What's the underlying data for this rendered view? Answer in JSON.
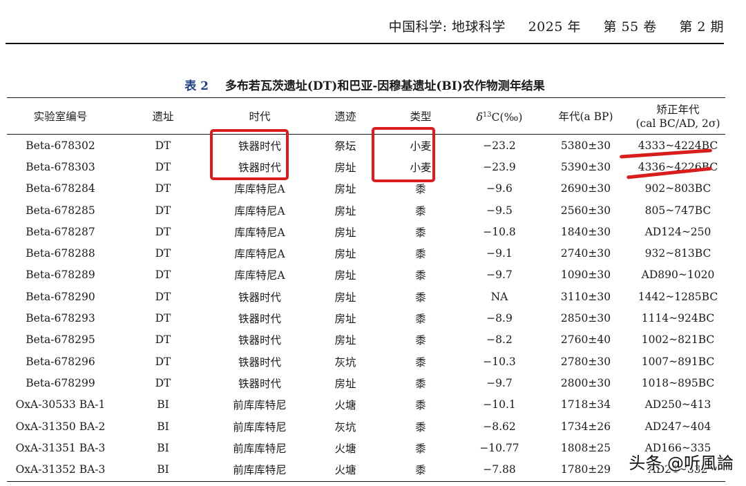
{
  "header": {
    "journal": "中国科学: 地球科学",
    "year": "2025 年",
    "volume": "第 55 卷",
    "issue": "第 2 期"
  },
  "caption": {
    "number": "表 2",
    "title": "多布若瓦茨遗址(DT)和巴亚-因穆基遗址(BI)农作物测年结果"
  },
  "table": {
    "headers": {
      "lab_id": "实验室编号",
      "site": "遗址",
      "period": "时代",
      "feature": "遗迹",
      "type": "类型",
      "delta_symbol": "δ",
      "delta_sup": "13",
      "delta_rest": "C(‰)",
      "age": "年代(a BP)",
      "cal_line1": "矫正年代",
      "cal_line2": "(cal BC/AD, 2σ)"
    },
    "rows": [
      {
        "lab_id": "Beta-678302",
        "site": "DT",
        "period": "铁器时代",
        "feature": "祭坛",
        "type": "小麦",
        "delta": "−23.2",
        "age": "5380±30",
        "cal": "4333~4224BC"
      },
      {
        "lab_id": "Beta-678303",
        "site": "DT",
        "period": "铁器时代",
        "feature": "房址",
        "type": "小麦",
        "delta": "−23.9",
        "age": "5390±30",
        "cal": "4336~4226BC"
      },
      {
        "lab_id": "Beta-678284",
        "site": "DT",
        "period": "库库特尼A",
        "feature": "房址",
        "type": "黍",
        "delta": "−9.6",
        "age": "2690±30",
        "cal": "902~803BC"
      },
      {
        "lab_id": "Beta-678285",
        "site": "DT",
        "period": "库库特尼A",
        "feature": "房址",
        "type": "黍",
        "delta": "−9.5",
        "age": "2560±30",
        "cal": "805~747BC"
      },
      {
        "lab_id": "Beta-678287",
        "site": "DT",
        "period": "库库特尼A",
        "feature": "房址",
        "type": "黍",
        "delta": "−10.8",
        "age": "1840±30",
        "cal": "AD124~250"
      },
      {
        "lab_id": "Beta-678288",
        "site": "DT",
        "period": "库库特尼A",
        "feature": "房址",
        "type": "黍",
        "delta": "−9.1",
        "age": "2740±30",
        "cal": "932~813BC"
      },
      {
        "lab_id": "Beta-678289",
        "site": "DT",
        "period": "库库特尼A",
        "feature": "房址",
        "type": "黍",
        "delta": "−9.7",
        "age": "1090±30",
        "cal": "AD890~1020"
      },
      {
        "lab_id": "Beta-678290",
        "site": "DT",
        "period": "铁器时代",
        "feature": "房址",
        "type": "黍",
        "delta": "NA",
        "age": "3110±30",
        "cal": "1442~1285BC"
      },
      {
        "lab_id": "Beta-678293",
        "site": "DT",
        "period": "铁器时代",
        "feature": "房址",
        "type": "黍",
        "delta": "−8.9",
        "age": "2850±30",
        "cal": "1114~924BC"
      },
      {
        "lab_id": "Beta-678295",
        "site": "DT",
        "period": "铁器时代",
        "feature": "房址",
        "type": "黍",
        "delta": "−8.2",
        "age": "2760±40",
        "cal": "1002~821BC"
      },
      {
        "lab_id": "Beta-678296",
        "site": "DT",
        "period": "铁器时代",
        "feature": "灰坑",
        "type": "黍",
        "delta": "−10.3",
        "age": "2780±30",
        "cal": "1007~891BC"
      },
      {
        "lab_id": "Beta-678299",
        "site": "DT",
        "period": "铁器时代",
        "feature": "房址",
        "type": "黍",
        "delta": "−9.7",
        "age": "2800±30",
        "cal": "1018~895BC"
      },
      {
        "lab_id": "OxA-30533 BA-1",
        "site": "BI",
        "period": "前库库特尼",
        "feature": "火塘",
        "type": "黍",
        "delta": "−10.1",
        "age": "1718±34",
        "cal": "AD250~413"
      },
      {
        "lab_id": "OxA-31350 BA-2",
        "site": "BI",
        "period": "前库库特尼",
        "feature": "灰坑",
        "type": "黍",
        "delta": "−8.62",
        "age": "1734±26",
        "cal": "AD247~404"
      },
      {
        "lab_id": "OxA-31351 BA-3",
        "site": "BI",
        "period": "前库库特尼",
        "feature": "火塘",
        "type": "黍",
        "delta": "−10.77",
        "age": "1808±25",
        "cal": "AD166~335"
      },
      {
        "lab_id": "OxA-31352 BA-3",
        "site": "BI",
        "period": "前库库特尼",
        "feature": "火塘",
        "type": "黍",
        "delta": "−7.88",
        "age": "1780±29",
        "cal": "AD24~332"
      }
    ]
  },
  "watermark": "头条 @听風論",
  "colors": {
    "highlight": "#d91c1c",
    "table_number": "#1f3f86"
  }
}
